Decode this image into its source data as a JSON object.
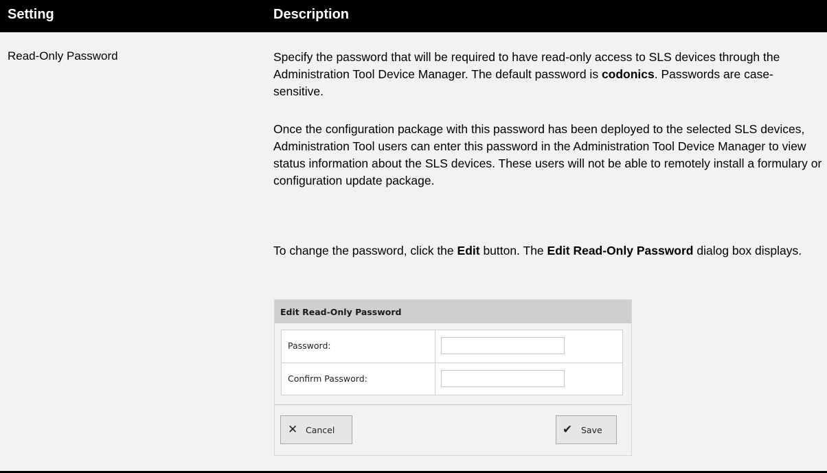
{
  "table": {
    "columns": [
      "Setting",
      "Description"
    ],
    "row": {
      "setting": "Read-Only Password",
      "paragraphs": [
        {
          "parts": [
            "Specify the password that will be required to have read-only access to SLS devices through the Administration Tool Device Manager. The default password is ",
            "codonics",
            ". Passwords are case-sensitive."
          ]
        },
        {
          "text": "Once the configuration package with this password has been deployed to the selected SLS devices, Administration Tool users can enter this password in the Administration Tool Device Manager to view status information about the SLS devices. These users will not be able to remotely install a formulary or configuration update package."
        },
        {
          "parts": [
            "To change the password, click the ",
            "Edit",
            " button. The ",
            "Edit Read-Only Password",
            " dialog box displays."
          ]
        }
      ]
    }
  },
  "dialog": {
    "title": "Edit Read-Only Password",
    "fields": [
      {
        "label": "Password:",
        "value": ""
      },
      {
        "label": "Confirm Password:",
        "value": ""
      }
    ],
    "cancel_label": "Cancel",
    "save_label": "Save",
    "cancel_icon": "close-icon",
    "save_icon": "check-icon"
  },
  "colors": {
    "header_bg": "#000000",
    "header_text": "#ffffff",
    "row_bg": "#f2f2f2",
    "dialog_title_bg": "#cfcfcf",
    "button_bg": "#e6e6e6"
  }
}
